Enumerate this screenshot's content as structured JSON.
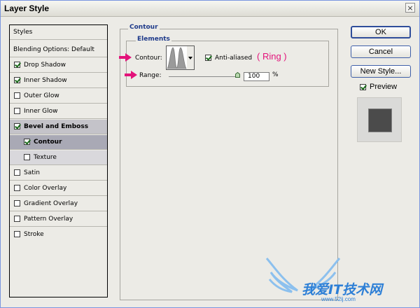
{
  "window": {
    "title": "Layer Style",
    "close_glyph": "×"
  },
  "styles_list": {
    "header": "Styles",
    "blending": "Blending Options: Default",
    "items": [
      {
        "label": "Drop Shadow",
        "checked": true
      },
      {
        "label": "Inner Shadow",
        "checked": true
      },
      {
        "label": "Outer Glow",
        "checked": false
      },
      {
        "label": "Inner Glow",
        "checked": false
      },
      {
        "label": "Bevel and Emboss",
        "checked": true
      },
      {
        "label": "Contour",
        "checked": true
      },
      {
        "label": "Texture",
        "checked": false
      },
      {
        "label": "Satin",
        "checked": false
      },
      {
        "label": "Color Overlay",
        "checked": false
      },
      {
        "label": "Gradient Overlay",
        "checked": false
      },
      {
        "label": "Pattern Overlay",
        "checked": false
      },
      {
        "label": "Stroke",
        "checked": false
      }
    ]
  },
  "panel": {
    "section_title": "Contour",
    "group_title": "Elements",
    "contour_label": "Contour:",
    "anti_aliased_label": "Anti-aliased",
    "anti_aliased_checked": true,
    "annotation": "( Ring )",
    "range_label": "Range:",
    "range_value": "100",
    "range_unit": "%",
    "range_fraction": 1.0
  },
  "buttons": {
    "ok": "OK",
    "cancel": "Cancel",
    "new_style": "New Style..."
  },
  "preview": {
    "label": "Preview",
    "checked": true
  },
  "watermark": {
    "text": "我爱IT技术网",
    "url": "www.52ij.com"
  },
  "colors": {
    "annotation_pink": "#e3127a",
    "heading_blue": "#1e3a8a",
    "watermark_blue": "#2d7fd6",
    "preview_swatch": "#4b4b4b"
  }
}
